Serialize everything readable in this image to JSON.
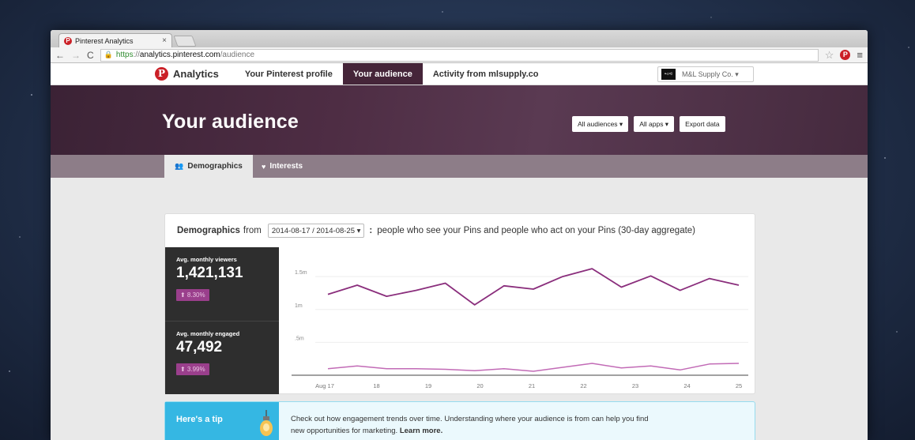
{
  "browser": {
    "tab_title": "Pinterest Analytics",
    "tab_close": "×",
    "url_https": "https",
    "url_sep": "://",
    "url_host": "analytics.pinterest.com",
    "url_path": "/audience"
  },
  "header": {
    "brand": "Analytics",
    "nav": [
      "Your Pinterest profile",
      "Your audience",
      "Activity from mlsupply.co"
    ],
    "active_nav": 1,
    "account": "M&L Supply Co. ▾",
    "account_avatar": "▪◃⊲"
  },
  "hero": {
    "title": "Your audience",
    "audiences_button": "All audiences ▾",
    "apps_button": "All apps ▾",
    "export_button": "Export data"
  },
  "subtabs": {
    "demographics": "Demographics",
    "interests": "Interests"
  },
  "card": {
    "heading_bold": "Demographics",
    "heading_from": "from",
    "date_range": "2014-08-17 / 2014-08-25 ▾",
    "colon": ":",
    "description": "people who see your Pins and people who act on your Pins (30-day aggregate)",
    "viewers_label": "Avg. monthly viewers",
    "viewers_value": "1,421,131",
    "viewers_change": "⬆ 8.30%",
    "engaged_label": "Avg. monthly engaged",
    "engaged_value": "47,492",
    "engaged_change": "⬆ 3.99%"
  },
  "chart_data": {
    "type": "line",
    "x": [
      "Aug 17",
      "",
      "18",
      "",
      "19",
      "",
      "20",
      "",
      "21",
      "",
      "22",
      "",
      "23",
      "",
      "24",
      "",
      "25"
    ],
    "x_tick_labels": [
      "Aug 17",
      "18",
      "19",
      "20",
      "21",
      "22",
      "23",
      "24",
      "25"
    ],
    "y_tick_labels": [
      "1.5m",
      "1m",
      ".5m"
    ],
    "ylim": [
      0,
      1.85
    ],
    "series": [
      {
        "values": [
          1.23,
          1.37,
          1.2,
          1.29,
          1.4,
          1.07,
          1.36,
          1.31,
          1.5,
          1.62,
          1.34,
          1.51,
          1.29,
          1.47,
          1.37,
          null,
          null
        ],
        "color": "#8a2e7c"
      },
      {
        "values": [
          0.1,
          0.14,
          0.1,
          0.1,
          0.09,
          0.07,
          0.1,
          0.06,
          0.12,
          0.18,
          0.11,
          0.14,
          0.08,
          0.17,
          0.18,
          null,
          null
        ],
        "color": "#c26bb6"
      }
    ],
    "grid": true
  },
  "tip": {
    "title": "Here's a tip",
    "line1": "Check out how engagement trends over time. Understanding where your audience is from can help you find",
    "line2": "new opportunities for marketing.",
    "learn_more": "Learn more."
  },
  "icons": [
    "pinterest-favicon",
    "back-arrow-icon",
    "forward-arrow-icon",
    "reload-icon",
    "lock-icon",
    "star-icon",
    "pinterest-extension-icon",
    "menu-icon",
    "pinterest-logo-icon",
    "people-icon",
    "heart-icon",
    "lightbulb-icon"
  ],
  "colors": {
    "pinterest_red": "#cb2027",
    "aubergine": "#452539",
    "line_dark": "#8a2e7c",
    "line_light": "#c26bb6",
    "tip_blue": "#35b7e3"
  }
}
